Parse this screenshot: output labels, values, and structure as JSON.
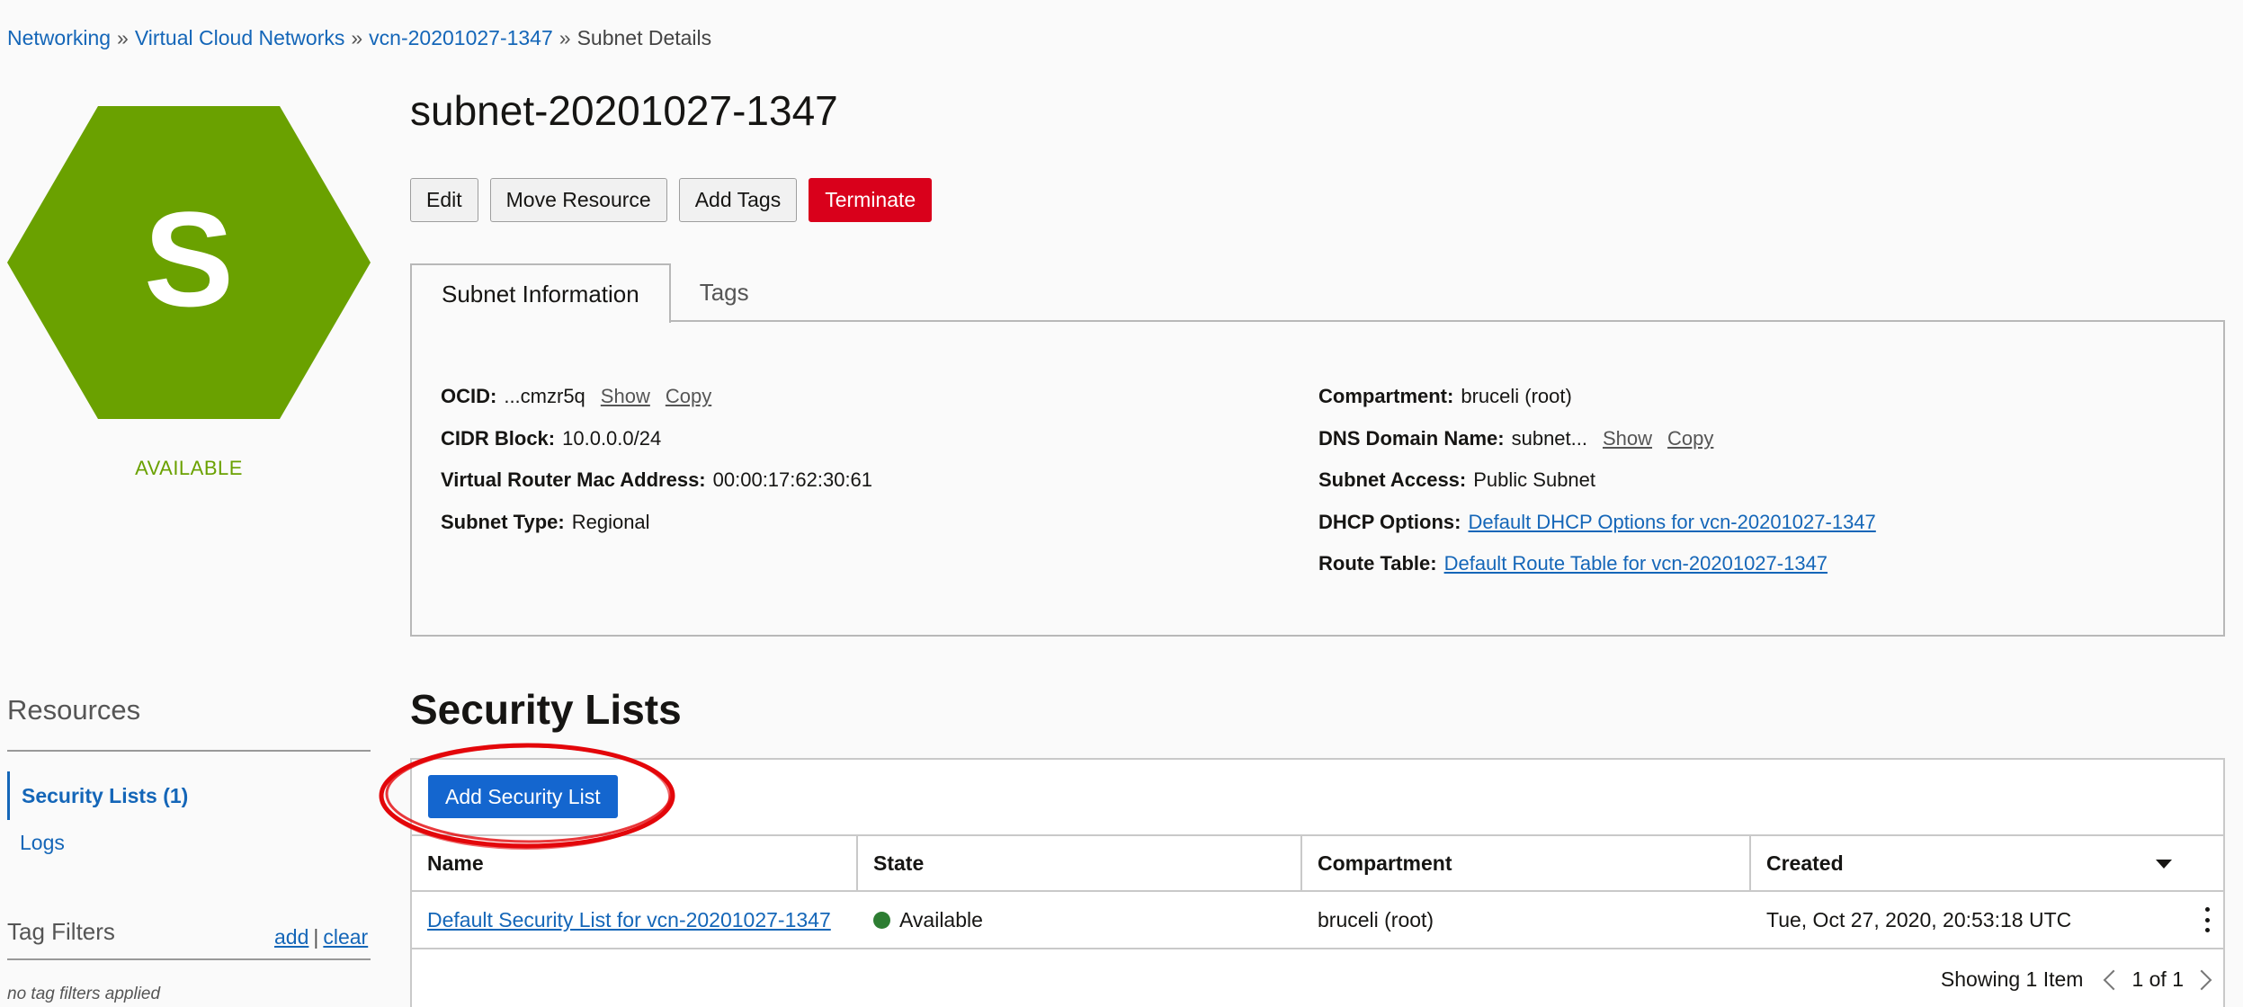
{
  "breadcrumb": {
    "items": [
      "Networking",
      "Virtual Cloud Networks",
      "vcn-20201027-1347"
    ],
    "current": "Subnet Details",
    "separator": "»"
  },
  "resource": {
    "icon_letter": "S",
    "icon_color": "#6aa100",
    "status": "AVAILABLE",
    "title": "subnet-20201027-1347"
  },
  "actions": {
    "edit": "Edit",
    "move": "Move Resource",
    "add_tags": "Add Tags",
    "terminate": "Terminate"
  },
  "tabs": {
    "info": "Subnet Information",
    "tags": "Tags"
  },
  "info": {
    "ocid_label": "OCID:",
    "ocid_value": "...cmzr5q",
    "show": "Show",
    "copy": "Copy",
    "cidr_label": "CIDR Block:",
    "cidr_value": "10.0.0.0/24",
    "mac_label": "Virtual Router Mac Address:",
    "mac_value": "00:00:17:62:30:61",
    "type_label": "Subnet Type:",
    "type_value": "Regional",
    "compartment_label": "Compartment:",
    "compartment_value": "bruceli (root)",
    "dns_label": "DNS Domain Name:",
    "dns_value": "subnet...",
    "access_label": "Subnet Access:",
    "access_value": "Public Subnet",
    "dhcp_label": "DHCP Options:",
    "dhcp_value": "Default DHCP Options for vcn-20201027-1347",
    "route_label": "Route Table:",
    "route_value": "Default Route Table for vcn-20201027-1347"
  },
  "sidebar": {
    "resources_title": "Resources",
    "items": [
      {
        "label": "Security Lists (1)"
      },
      {
        "label": "Logs"
      }
    ],
    "tag_filters_title": "Tag Filters",
    "tag_add": "add",
    "tag_separator": "|",
    "tag_clear": "clear",
    "tag_empty": "no tag filters applied"
  },
  "security_lists": {
    "title": "Security Lists",
    "add_button": "Add Security List",
    "highlight_color": "#e3060a",
    "columns": [
      "Name",
      "State",
      "Compartment",
      "Created"
    ],
    "rows": [
      {
        "name": "Default Security List for vcn-20201027-1347",
        "state": "Available",
        "state_color": "#2d7d32",
        "compartment": "bruceli (root)",
        "created": "Tue, Oct 27, 2020, 20:53:18 UTC"
      }
    ],
    "showing": "Showing 1 Item",
    "page": "1 of 1"
  }
}
